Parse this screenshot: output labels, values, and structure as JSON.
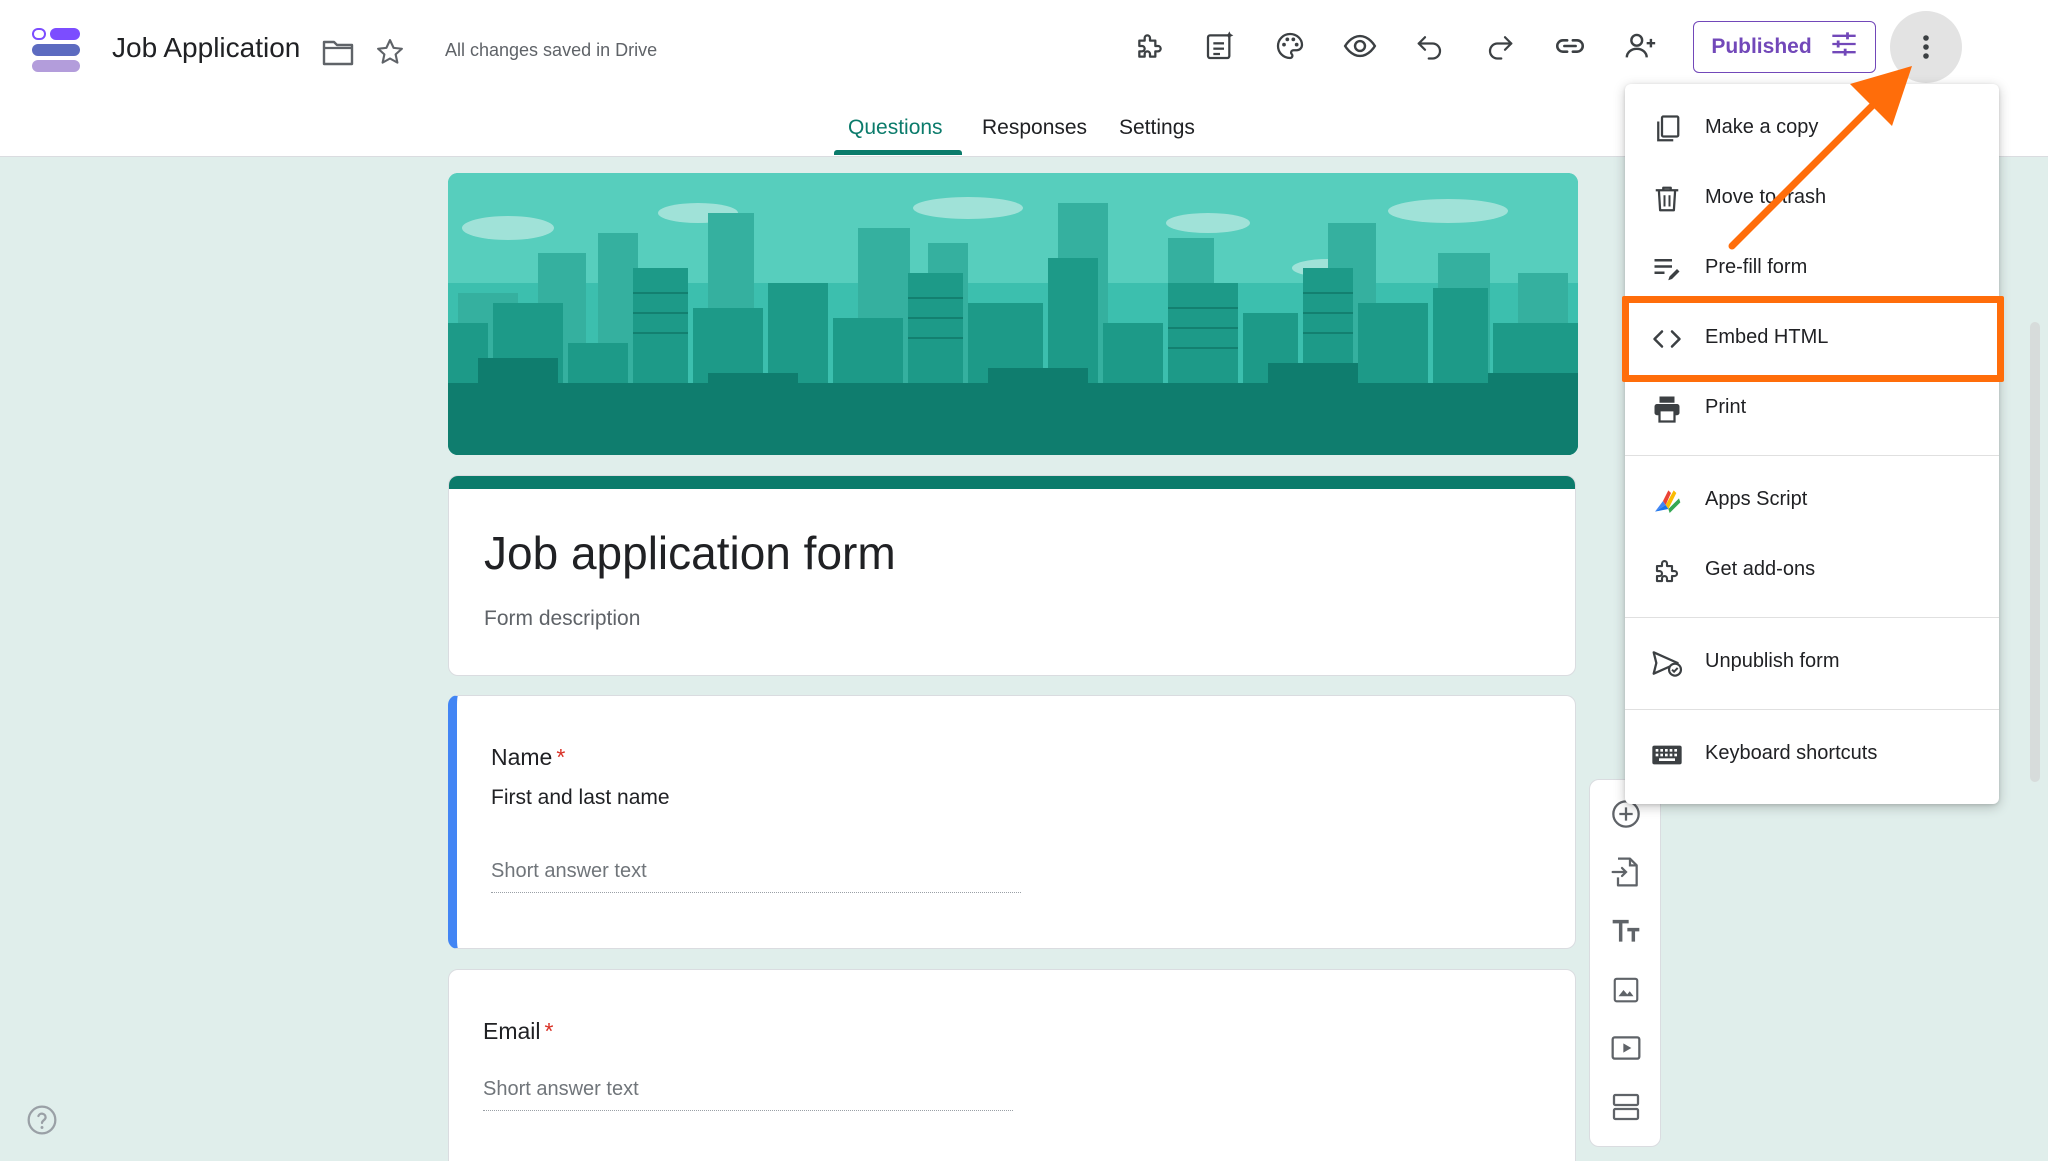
{
  "header": {
    "app_title": "Job Application",
    "save_status": "All changes saved in Drive",
    "publish_label": "Published",
    "toolbar_icons": [
      "add-ons-icon",
      "ai-assist-icon",
      "palette-icon",
      "preview-icon",
      "undo-icon",
      "redo-icon",
      "link-icon",
      "add-collaborator-icon"
    ]
  },
  "tabs": {
    "questions": "Questions",
    "responses": "Responses",
    "settings": "Settings",
    "active": "Questions"
  },
  "form": {
    "title": "Job application form",
    "description": "Form description",
    "questions": [
      {
        "label": "Name",
        "required_mark": "*",
        "help": "First and last name",
        "placeholder": "Short answer text"
      },
      {
        "label": "Email",
        "required_mark": "*",
        "placeholder": "Short answer text"
      }
    ]
  },
  "menu": {
    "items": [
      {
        "label": "Make a copy",
        "icon": "copy-icon"
      },
      {
        "label": "Move to trash",
        "icon": "trash-icon"
      },
      {
        "label": "Pre-fill form",
        "icon": "prefill-icon"
      },
      {
        "label": "Embed HTML",
        "icon": "code-icon"
      },
      {
        "label": "Print",
        "icon": "print-icon"
      },
      {
        "label": "Apps Script",
        "icon": "apps-script-icon"
      },
      {
        "label": "Get add-ons",
        "icon": "add-ons-icon"
      },
      {
        "label": "Unpublish form",
        "icon": "unpublish-icon"
      },
      {
        "label": "Keyboard shortcuts",
        "icon": "keyboard-icon"
      }
    ],
    "highlighted": "Embed HTML"
  },
  "side_toolbar": [
    "add-question-icon",
    "import-questions-icon",
    "add-title-icon",
    "add-image-icon",
    "add-video-icon",
    "add-section-icon"
  ],
  "colors": {
    "accent": "#0b7b6b",
    "background": "#e0eeeb",
    "publish": "#7248b9",
    "highlight": "#ff6d0a",
    "active_question": "#4285f4"
  }
}
